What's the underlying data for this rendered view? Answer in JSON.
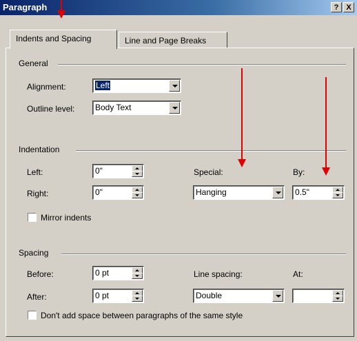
{
  "window": {
    "title": "Paragraph",
    "help_button": "?",
    "close_button": "X"
  },
  "tabs": [
    {
      "label": "Indents and Spacing",
      "active": true
    },
    {
      "label": "Line and Page Breaks",
      "active": false
    }
  ],
  "general": {
    "group_label": "General",
    "alignment_label": "Alignment:",
    "alignment_value": "Left",
    "outline_label": "Outline level:",
    "outline_value": "Body Text"
  },
  "indentation": {
    "group_label": "Indentation",
    "left_label": "Left:",
    "left_value": "0\"",
    "right_label": "Right:",
    "right_value": "0\"",
    "special_label": "Special:",
    "special_value": "Hanging",
    "by_label": "By:",
    "by_value": "0.5\"",
    "mirror_label": "Mirror indents",
    "mirror_checked": false
  },
  "spacing": {
    "group_label": "Spacing",
    "before_label": "Before:",
    "before_value": "0 pt",
    "after_label": "After:",
    "after_value": "0 pt",
    "line_spacing_label": "Line spacing:",
    "line_spacing_value": "Double",
    "at_label": "At:",
    "at_value": "",
    "dont_add_label": "Don't add space between paragraphs of the same style",
    "dont_add_checked": false
  },
  "colors": {
    "title_bar_start": "#0a246a",
    "title_bar_end": "#a6caf0",
    "dialog_face": "#d4d0c8",
    "annotation_arrow": "#e00000"
  }
}
